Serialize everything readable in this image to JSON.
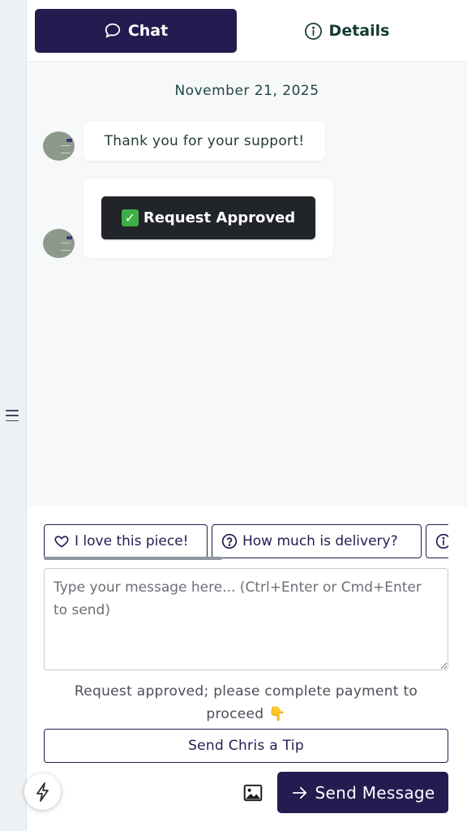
{
  "tabs": {
    "chat_label": "Chat",
    "details_label": "Details"
  },
  "chat": {
    "date": "November 21, 2025",
    "messages": [
      {
        "text": "Thank you for your support!"
      },
      {
        "action_label": "Request Approved",
        "action_icon": "white-check-mark-emoji"
      }
    ]
  },
  "quick_replies": [
    {
      "icon": "heart-icon",
      "label": "I love this piece!"
    },
    {
      "icon": "question-circle-icon",
      "label": "How much is delivery?"
    },
    {
      "icon": "info-circle-icon",
      "label": ""
    }
  ],
  "composer": {
    "placeholder": "Type your message here... (Ctrl+Enter or Cmd+Enter to send)",
    "value": ""
  },
  "notice": {
    "text": "Request approved; please complete payment to proceed",
    "emoji": "👇"
  },
  "tip_button_label": "Send Chris a Tip",
  "send_button_label": "Send Message",
  "colors": {
    "primary": "#221c50",
    "dark_button": "#212529",
    "chat_background": "#f7f8f9",
    "accent_text": "#1d4640"
  }
}
